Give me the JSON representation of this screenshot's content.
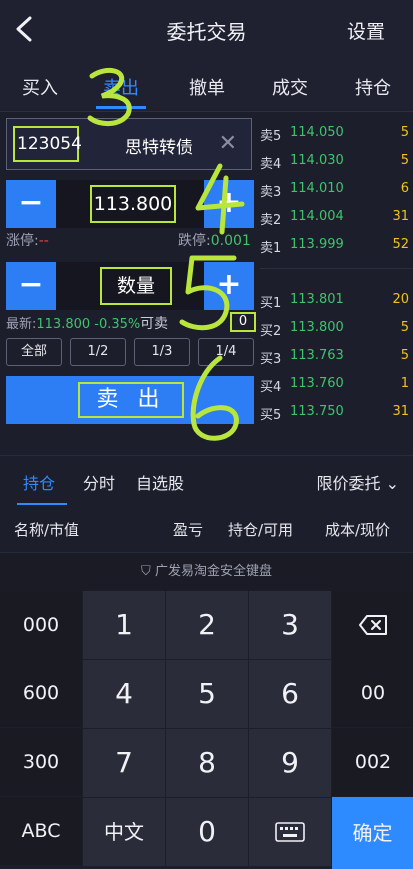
{
  "header": {
    "title": "委托交易",
    "settings": "设置"
  },
  "tabs": [
    "买入",
    "卖出",
    "撤单",
    "成交",
    "持仓"
  ],
  "form": {
    "code": "123054",
    "name": "思特转债",
    "price": "113.800",
    "limit_up_label": "涨停:",
    "limit_up_value": "--",
    "limit_down_label": "跌停:",
    "limit_down_value": "0.001",
    "qty_placeholder": "数量",
    "latest_label": "最新:",
    "latest_value": "113.800 -0.35%",
    "sellable_label": "可卖",
    "sellable_value": "0",
    "fractions": [
      "全部",
      "1/2",
      "1/3",
      "1/4"
    ],
    "sell_button": "卖 出"
  },
  "asks": [
    {
      "label": "卖5",
      "price": "114.050",
      "vol": "5"
    },
    {
      "label": "卖4",
      "price": "114.030",
      "vol": "5"
    },
    {
      "label": "卖3",
      "price": "114.010",
      "vol": "6"
    },
    {
      "label": "卖2",
      "price": "114.004",
      "vol": "31"
    },
    {
      "label": "卖1",
      "price": "113.999",
      "vol": "52"
    }
  ],
  "bids": [
    {
      "label": "买1",
      "price": "113.801",
      "vol": "20"
    },
    {
      "label": "买2",
      "price": "113.800",
      "vol": "5"
    },
    {
      "label": "买3",
      "price": "113.763",
      "vol": "5"
    },
    {
      "label": "买4",
      "price": "113.760",
      "vol": "1"
    },
    {
      "label": "买5",
      "price": "113.750",
      "vol": "31"
    }
  ],
  "lower_tabs": [
    "持仓",
    "分时",
    "自选股"
  ],
  "order_type": "限价委托",
  "columns": [
    "名称/市值",
    "盈亏",
    "持仓/可用",
    "成本/现价"
  ],
  "keyboard": {
    "title": "广发易淘金安全键盘",
    "left": [
      "000",
      "600",
      "300",
      "ABC"
    ],
    "nums": [
      "1",
      "2",
      "3",
      "4",
      "5",
      "6",
      "7",
      "8",
      "9"
    ],
    "right": [
      "00",
      "002"
    ],
    "chinese": "中文",
    "zero": "0",
    "ok": "确定"
  },
  "annotations": [
    "3",
    "4",
    "5",
    "6"
  ]
}
